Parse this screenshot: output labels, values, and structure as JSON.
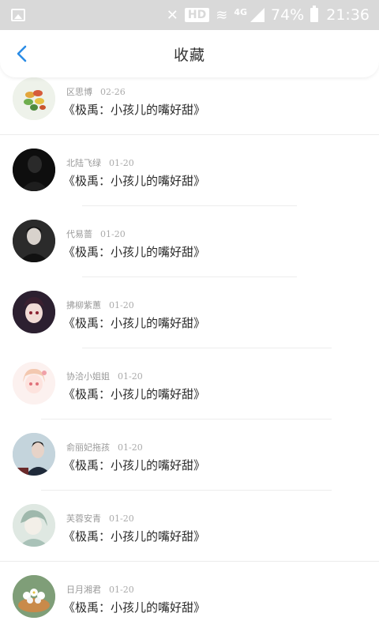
{
  "status_bar": {
    "network": "4G",
    "hd": "HD",
    "battery": "74%",
    "time": "21:36"
  },
  "header": {
    "title": "收藏"
  },
  "items": [
    {
      "user": "区思博",
      "date": "02-26",
      "book": "《极禹：小孩儿的嘴好甜》"
    },
    {
      "user": "北陆飞绿",
      "date": "01-20",
      "book": "《极禹：小孩儿的嘴好甜》"
    },
    {
      "user": "代易蔷",
      "date": "01-20",
      "book": "《极禹：小孩儿的嘴好甜》"
    },
    {
      "user": "拂柳紫蕙",
      "date": "01-20",
      "book": "《极禹：小孩儿的嘴好甜》"
    },
    {
      "user": "协洽小姐姐",
      "date": "01-20",
      "book": "《极禹：小孩儿的嘴好甜》"
    },
    {
      "user": "俞丽妃拖孩",
      "date": "01-20",
      "book": "《极禹：小孩儿的嘴好甜》"
    },
    {
      "user": "芙蓉安青",
      "date": "01-20",
      "book": "《极禹：小孩儿的嘴好甜》"
    },
    {
      "user": "日月湘君",
      "date": "01-20",
      "book": "《极禹：小孩儿的嘴好甜》"
    }
  ],
  "colors": {
    "accent": "#2b8ce6",
    "status_bar": "#d9d9d9"
  }
}
